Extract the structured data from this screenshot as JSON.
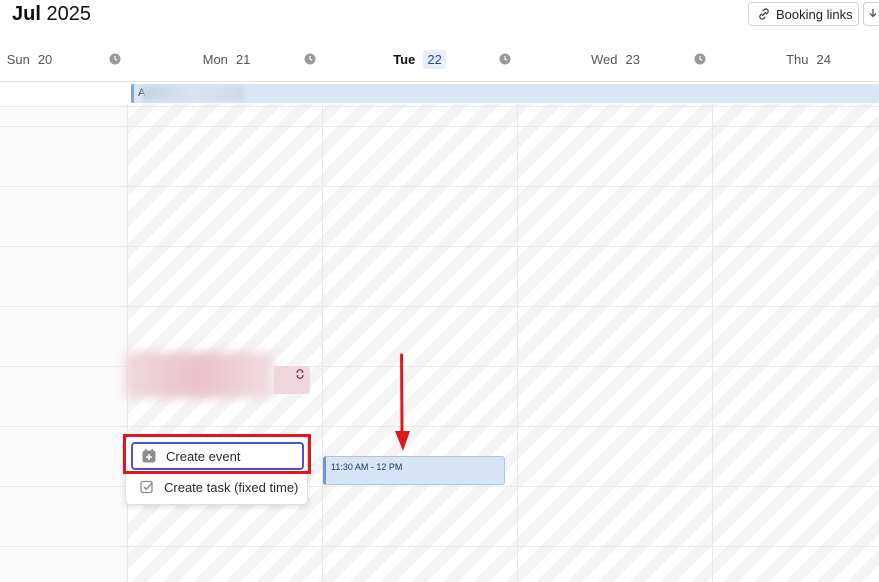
{
  "header": {
    "month": "Jul",
    "year": "2025",
    "booking_links_label": "Booking links"
  },
  "days": [
    {
      "name": "Sun",
      "num": "20"
    },
    {
      "name": "Mon",
      "num": "21"
    },
    {
      "name": "Tue",
      "num": "22",
      "active": true
    },
    {
      "name": "Wed",
      "num": "23"
    },
    {
      "name": "Thu",
      "num": "24"
    }
  ],
  "all_day": {
    "label": "A"
  },
  "context_menu": {
    "create_event": "Create event",
    "create_task": "Create task (fixed time)"
  },
  "selection": {
    "time_range": "11:30 AM - 12 PM"
  },
  "colors": {
    "selection_fill": "#d6e4f6",
    "annotation_red": "#e0161c",
    "menu_focus": "#4a56c8"
  },
  "icons": [
    "link-icon",
    "clock-icon",
    "recurring-icon",
    "calendar-plus-icon",
    "checkbox-icon",
    "arrow-down-icon"
  ]
}
